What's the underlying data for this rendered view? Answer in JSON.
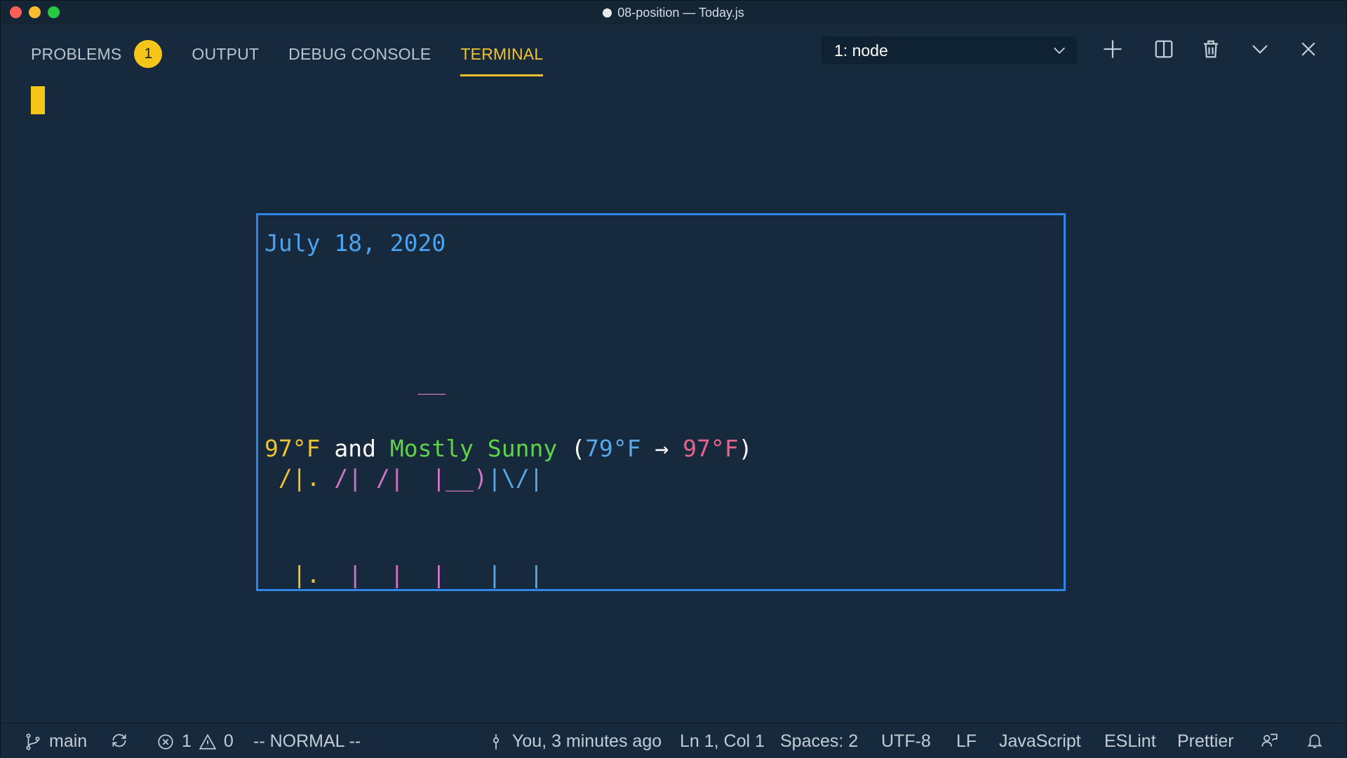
{
  "window": {
    "title": "08-position — Today.js"
  },
  "panel": {
    "tabs": [
      {
        "label": "PROBLEMS",
        "badge": "1"
      },
      {
        "label": "OUTPUT"
      },
      {
        "label": "DEBUG CONSOLE"
      },
      {
        "label": "TERMINAL",
        "active": true
      }
    ],
    "terminal_select": "1: node"
  },
  "terminal": {
    "date": "July 18, 2020",
    "time_art": {
      "top": {
        "c": "  ",
        "d": "       ",
        "m": "  __   "
      },
      "middle": {
        "h1": " /|",
        "colon": ".",
        "h2": " /|",
        "sp": " ",
        "m1": "/|",
        "sp2": "  ",
        "p": "|__)",
        "m": "|\\/|"
      },
      "bottom": {
        "h1": "  |",
        "colon": ".",
        "h2": "  |",
        "sp": "  ",
        "m1": "|",
        "sp2": "  ",
        "p": "|   ",
        "m": "|  |"
      }
    },
    "weather": {
      "current_temp": "97°F",
      "and": "and",
      "condition": "Mostly Sunny",
      "open_paren": "(",
      "low": "79°F",
      "arrow": "→",
      "high": "97°F",
      "close_paren": ")"
    }
  },
  "statusbar": {
    "branch": "main",
    "errors": "1",
    "warnings": "0",
    "mode": "-- NORMAL --",
    "blame": "You, 3 minutes ago",
    "position": "Ln 1, Col 1",
    "spaces": "Spaces: 2",
    "encoding": "UTF-8",
    "eol": "LF",
    "language": "JavaScript",
    "eslint": "ESLint",
    "prettier": "Prettier"
  },
  "colors": {
    "accent": "#f0c22e",
    "box_border": "#2f86e8",
    "background": "#172a3d"
  }
}
